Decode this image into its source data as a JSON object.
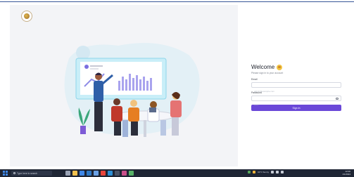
{
  "login": {
    "welcome": "Welcome",
    "subtitle": "Please sign in to your account",
    "email_label": "Email",
    "email_placeholder": "admin@example.com",
    "password_label": "Password",
    "password_placeholder": "••••••",
    "signin_label": "Sign in"
  },
  "taskbar": {
    "search_text": "Type here to search",
    "weather": "31°C Sunny",
    "time": "12:00",
    "date": "1/1/2024"
  },
  "colors": {
    "accent": "#6a48d8",
    "taskbar": "#1f2635"
  }
}
